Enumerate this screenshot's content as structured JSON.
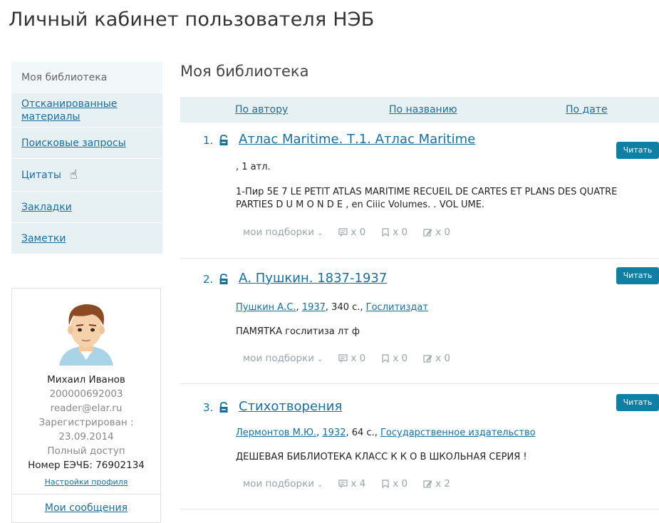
{
  "page_title": "Личный кабинет пользователя НЭБ",
  "sidebar": {
    "items": [
      {
        "label": "Моя библиотека",
        "active": true
      },
      {
        "label": "Отсканированные материалы"
      },
      {
        "label": "Поисковые запросы"
      },
      {
        "label": "Цитаты"
      },
      {
        "label": "Закладки"
      },
      {
        "label": "Заметки"
      }
    ]
  },
  "profile": {
    "name": "Михаил Иванов",
    "id": "200000692003",
    "email": "reader@elar.ru",
    "registered_label": "Зарегистрирован :",
    "registered_date": "23.09.2014",
    "access": "Полный доступ",
    "eechb": "Номер ЕЭЧБ: 76902134",
    "settings_link": "Настройки профиля",
    "messages_link": "Мои сообщения"
  },
  "main": {
    "heading": "Моя библиотека",
    "sort": {
      "by_author": "По автору",
      "by_title": "По названию",
      "by_date": "По дате"
    },
    "read_label": "Читать",
    "collections_label": "мои подборки",
    "entries": [
      {
        "num": "1.",
        "title": "Атлас Maritime. Т.1. Атлас Maritime",
        "meta_plain": ", 1 атл.",
        "desc": "1-Пир 5Е 7 LE PETIT ATLAS MARITIME RECUEIL DE CARTES ET PLANS DES QUATRE PARTIES D U M O N D E , en Ciiic Volumes. . VOL UME.",
        "quotes": "x 0",
        "bookmarks": "x 0",
        "notes": "x 0"
      },
      {
        "num": "2.",
        "title": "А. Пушкин. 1837-1937",
        "author": "Пушкин А.С.",
        "year": "1937",
        "pages": ", 340 с.,",
        "publisher": "Гослитиздат",
        "desc": "ПАМЯТКА гослитиза лт ф",
        "quotes": "x 0",
        "bookmarks": "x 0",
        "notes": "x 0"
      },
      {
        "num": "3.",
        "title": "Стихотворения",
        "author": "Лермонтов М.Ю.",
        "year": "1932",
        "pages": ", 64 с.,",
        "publisher": "Государственное издательство",
        "desc": "ДЕШЕВАЯ БИБЛИОТЕКА КЛАСС К К О В ШКОЛЬНАЯ СЕРИЯ !",
        "quotes": "x 4",
        "bookmarks": "x 0",
        "notes": "x 2"
      }
    ]
  },
  "colors": {
    "accent": "#1a6e99",
    "button": "#0f7fa3",
    "sidebar_bg": "#e7f1f4"
  }
}
